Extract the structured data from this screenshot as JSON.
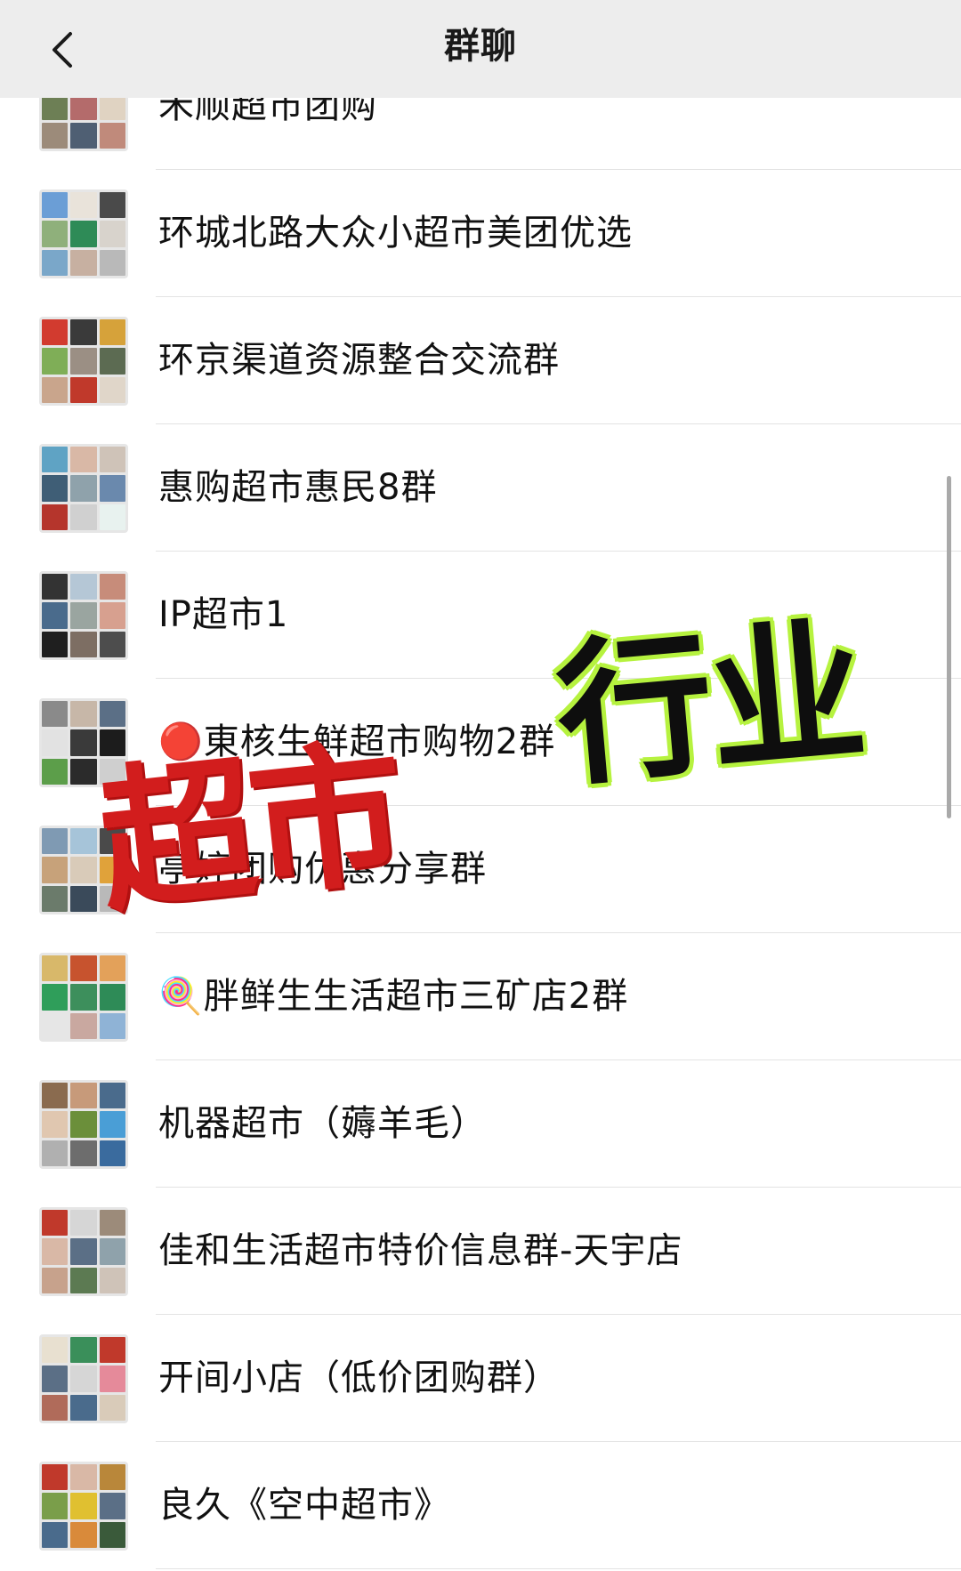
{
  "header": {
    "title": "群聊",
    "back_icon": "chevron-left-icon"
  },
  "groups": [
    {
      "name": "禾顺超市团购",
      "colors": [
        "#c9a38c",
        "#8aa0b8",
        "#d9c7b4",
        "#6d7f55",
        "#b46b6b",
        "#e0d3c2",
        "#9c8b7a",
        "#4f5f73",
        "#c08a7b"
      ]
    },
    {
      "name": "环城北路大众小超市美团优选",
      "colors": [
        "#6b9ed6",
        "#e9e3da",
        "#4a4a4a",
        "#8fb07b",
        "#2e8b57",
        "#d8d3cc",
        "#7aa7c9",
        "#c7b0a1",
        "#b9b9b9"
      ]
    },
    {
      "name": "环京渠道资源整合交流群",
      "colors": [
        "#d23b2f",
        "#3a3a3a",
        "#d6a23a",
        "#7fae57",
        "#9b8f84",
        "#5c6b52",
        "#c9a58c",
        "#c0392b",
        "#e0d6c9"
      ]
    },
    {
      "name": "惠购超市惠民8群",
      "colors": [
        "#5fa3c4",
        "#d9b8a6",
        "#cfc3b8",
        "#3f5e76",
        "#8fa2ab",
        "#6a89ad",
        "#b5352c",
        "#d0d0d0",
        "#e8f2ef"
      ]
    },
    {
      "name": "IP超市1",
      "colors": [
        "#333333",
        "#b5c7d6",
        "#c78c7a",
        "#4a6b8c",
        "#9aa5a0",
        "#d7a08f",
        "#1f1f1f",
        "#7d6e63",
        "#4d4d4d"
      ]
    },
    {
      "name": "🔴東核生鲜超市购物2群",
      "colors": [
        "#8a8a8a",
        "#c7b7a8",
        "#5b6f86",
        "#e2e2e2",
        "#3a3a3a",
        "#1c1c1c",
        "#5c9e4a",
        "#2b2b2b",
        "#cfcfcf"
      ]
    },
    {
      "name": "亭婷团购优惠分享群",
      "colors": [
        "#7f9ab3",
        "#a6c4d9",
        "#4a4a4a",
        "#c7a27a",
        "#d9cbb9",
        "#e0a23a",
        "#6b7b6b",
        "#3a4a5a",
        "#b9b9b9"
      ]
    },
    {
      "name": "🍭胖鲜生生活超市三矿店2群",
      "colors": [
        "#d8b86a",
        "#c7532e",
        "#e3a15a",
        "#2f9e5a",
        "#3d8f5c",
        "#2e8b57",
        "#e6e6e6",
        "#c9a8a0",
        "#8fb3d6"
      ]
    },
    {
      "name": "机器超市（薅羊毛）",
      "colors": [
        "#8a6b4f",
        "#c79a7a",
        "#4a6b8c",
        "#e0c7b0",
        "#6b8f3a",
        "#4a9ed6",
        "#b0b0b0",
        "#6d6d6d",
        "#3a6b9e"
      ]
    },
    {
      "name": "佳和生活超市特价信息群-天宇店",
      "colors": [
        "#c0392b",
        "#d6d6d6",
        "#9c8b7a",
        "#d9b8a6",
        "#5b6f86",
        "#8fa2ab",
        "#c7a28c",
        "#5c7a52",
        "#cfc3b8"
      ]
    },
    {
      "name": "开间小店（低价团购群）",
      "colors": [
        "#e8e0d0",
        "#3a8f5a",
        "#c0392b",
        "#5b6f86",
        "#d6d6d6",
        "#e58a9a",
        "#b06b5a",
        "#4a6b8c",
        "#d9cbb9"
      ]
    },
    {
      "name": "良久《空中超市》",
      "colors": [
        "#c0392b",
        "#d9b8a6",
        "#b9873a",
        "#7a9e4a",
        "#e0c030",
        "#5b6f86",
        "#4a6b8c",
        "#d98a3a",
        "#3a5a3a"
      ]
    }
  ],
  "overlay": {
    "red_text": "超市",
    "black_text": "行业"
  },
  "colors": {
    "header_bg": "#ededed",
    "divider": "#e3e3e3",
    "stamp_red": "#d21d1d",
    "stamp_glow": "#b6f23f"
  }
}
